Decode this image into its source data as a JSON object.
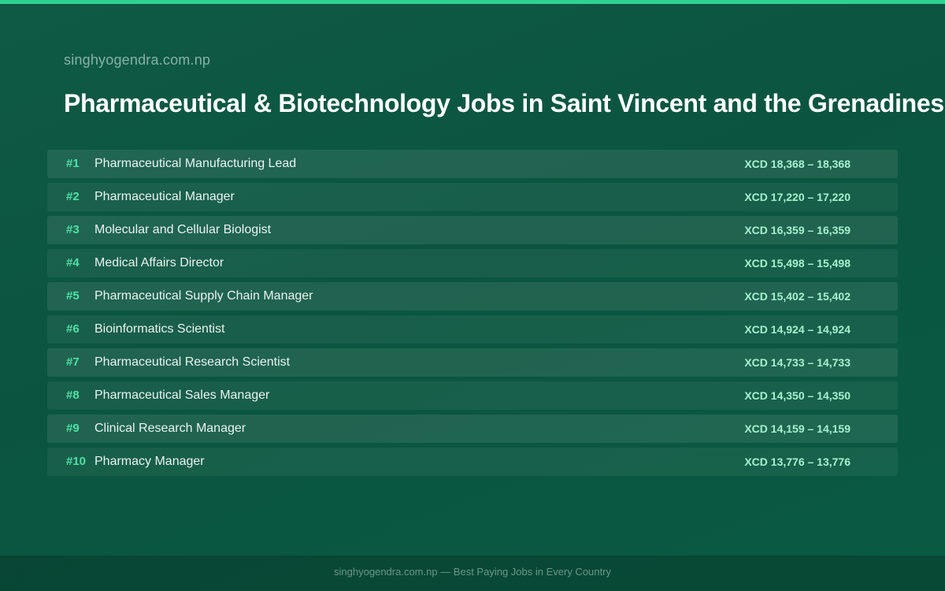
{
  "site": "singhyogendra.com.np",
  "title": "Pharmaceutical & Biotechnology Jobs in Saint Vincent and the Grenadines",
  "jobs": [
    {
      "rank": "#1",
      "title": "Pharmaceutical Manufacturing Lead",
      "salary": "XCD 18,368 – 18,368"
    },
    {
      "rank": "#2",
      "title": "Pharmaceutical Manager",
      "salary": "XCD 17,220 – 17,220"
    },
    {
      "rank": "#3",
      "title": "Molecular and Cellular Biologist",
      "salary": "XCD 16,359 – 16,359"
    },
    {
      "rank": "#4",
      "title": "Medical Affairs Director",
      "salary": "XCD 15,498 – 15,498"
    },
    {
      "rank": "#5",
      "title": "Pharmaceutical Supply Chain Manager",
      "salary": "XCD 15,402 – 15,402"
    },
    {
      "rank": "#6",
      "title": "Bioinformatics Scientist",
      "salary": "XCD 14,924 – 14,924"
    },
    {
      "rank": "#7",
      "title": "Pharmaceutical Research Scientist",
      "salary": "XCD 14,733 – 14,733"
    },
    {
      "rank": "#8",
      "title": "Pharmaceutical Sales Manager",
      "salary": "XCD 14,350 – 14,350"
    },
    {
      "rank": "#9",
      "title": "Clinical Research Manager",
      "salary": "XCD 14,159 – 14,159"
    },
    {
      "rank": "#10",
      "title": "Pharmacy Manager",
      "salary": "XCD 13,776 – 13,776"
    }
  ],
  "footer": "singhyogendra.com.np — Best Paying Jobs in Every Country",
  "colors": {
    "accent": "#2fd193",
    "rank": "#4fe0a6",
    "salary": "#a7f0cf",
    "background": "#0b5540"
  }
}
